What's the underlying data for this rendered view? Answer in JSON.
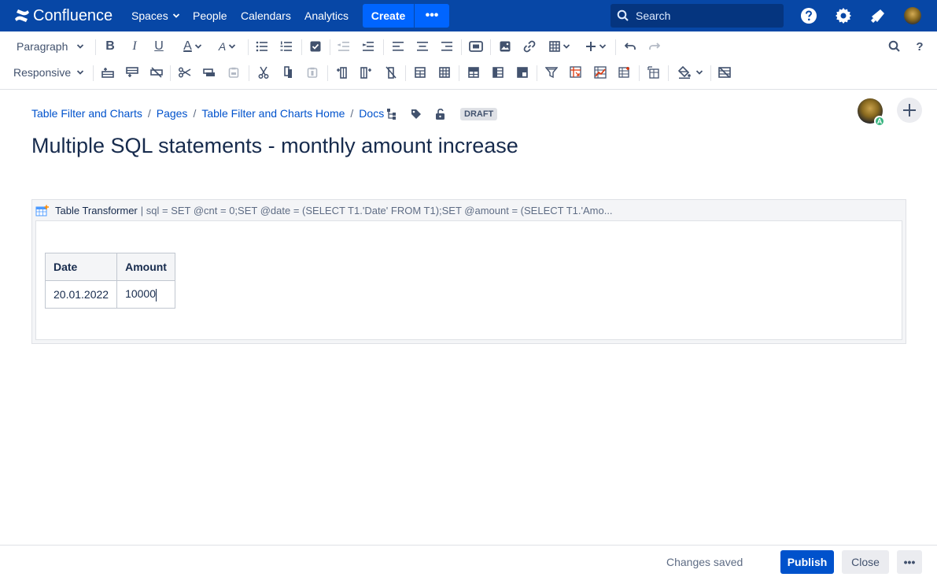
{
  "nav": {
    "logo_text": "Confluence",
    "items": [
      "Spaces",
      "People",
      "Calendars",
      "Analytics"
    ],
    "create_label": "Create",
    "create_more_label": "•••",
    "search_placeholder": "Search",
    "brand_color": "#0747a6",
    "accent_color": "#0065ff"
  },
  "toolbar": {
    "paragraph_label": "Paragraph",
    "responsive_label": "Responsive"
  },
  "breadcrumb": [
    "Table Filter and Charts",
    "Pages",
    "Table Filter and Charts Home",
    "Docs"
  ],
  "draft_label": "DRAFT",
  "avatar_badge": "A",
  "page_title": "Multiple SQL statements - monthly amount increase",
  "macro": {
    "name": "Table Transformer",
    "params": "| sql = SET @cnt = 0;SET @date = (SELECT T1.'Date' FROM T1);SET @amount = (SELECT T1.'Amo...",
    "table": {
      "headers": [
        "Date",
        "Amount"
      ],
      "rows": [
        [
          "20.01.2022",
          "10000"
        ]
      ]
    }
  },
  "footer": {
    "status": "Changes saved",
    "publish_label": "Publish",
    "close_label": "Close",
    "more_label": "•••"
  }
}
